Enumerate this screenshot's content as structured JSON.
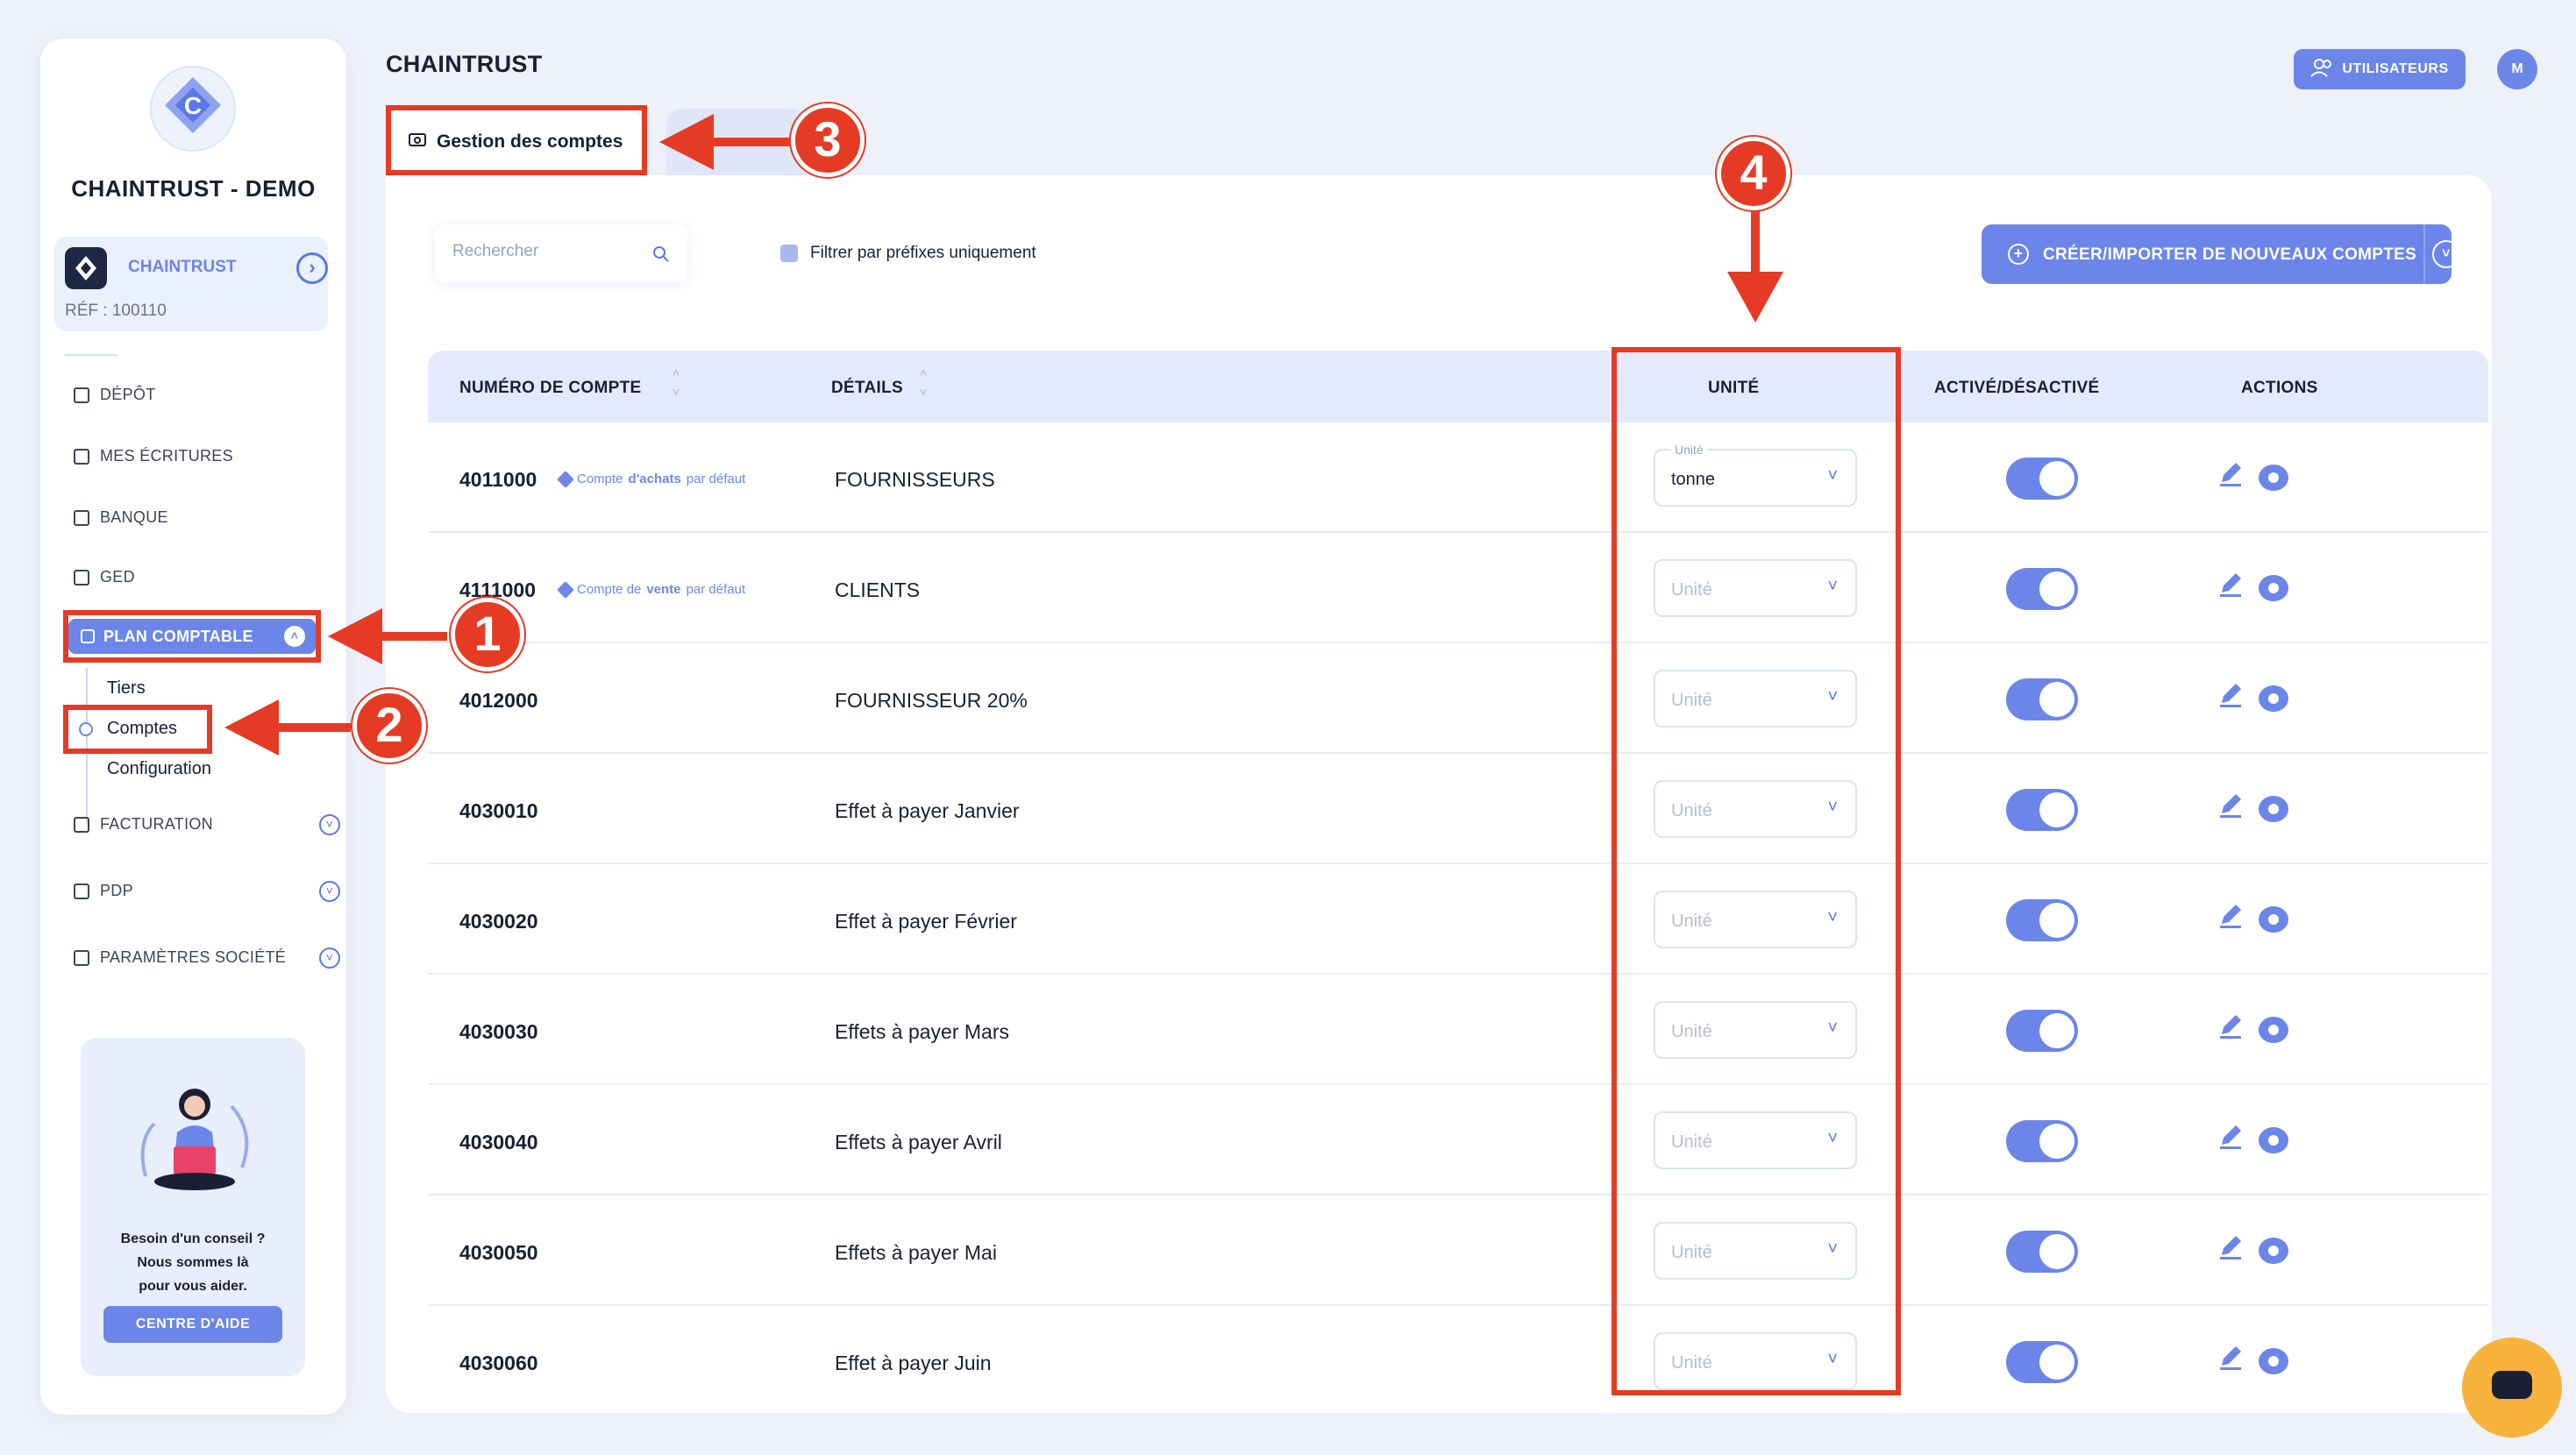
{
  "sidebar": {
    "brand": "CHAINTRUST - DEMO",
    "company": {
      "name": "CHAINTRUST",
      "ref": "RÉF : 100110"
    },
    "nav": [
      {
        "label": "DÉPÔT"
      },
      {
        "label": "MES ÉCRITURES"
      },
      {
        "label": "BANQUE"
      },
      {
        "label": "GED"
      }
    ],
    "active": {
      "label": "PLAN COMPTABLE"
    },
    "subitems": [
      {
        "label": "Tiers"
      },
      {
        "label": "Comptes"
      },
      {
        "label": "Configuration"
      }
    ],
    "nav_bottom": [
      {
        "label": "FACTURATION"
      },
      {
        "label": "PDP"
      },
      {
        "label": "PARAMÈTRES SOCIÉTÉ"
      }
    ],
    "help": {
      "line1": "Besoin d'un conseil ?",
      "line2": "Nous sommes là",
      "line3": "pour vous aider.",
      "button": "CENTRE D'AIDE"
    }
  },
  "header": {
    "title": "CHAINTRUST",
    "users_button": "UTILISATEURS",
    "avatar": "M"
  },
  "tabs": {
    "active": "Gestion des comptes"
  },
  "toolbar": {
    "search_placeholder": "Rechercher",
    "filter_label": "Filtrer par préfixes uniquement",
    "create_button": "CRÉER/IMPORTER DE NOUVEAUX COMPTES"
  },
  "table": {
    "headers": {
      "account": "NUMÉRO DE COMPTE",
      "details": "DÉTAILS",
      "unit": "UNITÉ",
      "active": "ACTIVÉ/DÉSACTIVÉ",
      "actions": "ACTIONS"
    },
    "unit_label": "Unité",
    "rows": [
      {
        "account": "4011000",
        "tag_pre": "Compte",
        "tag_bold": "d'achats",
        "tag_post": "par défaut",
        "details": "FOURNISSEURS",
        "unit": "tonne",
        "active": true
      },
      {
        "account": "4111000",
        "tag_pre": "Compte de",
        "tag_bold": "vente",
        "tag_post": "par défaut",
        "details": "CLIENTS",
        "unit": "",
        "active": true
      },
      {
        "account": "4012000",
        "details": "FOURNISSEUR 20%",
        "unit": "",
        "active": true
      },
      {
        "account": "4030010",
        "details": "Effet à payer Janvier",
        "unit": "",
        "active": true
      },
      {
        "account": "4030020",
        "details": "Effet à payer Février",
        "unit": "",
        "active": true
      },
      {
        "account": "4030030",
        "details": "Effets à payer Mars",
        "unit": "",
        "active": true
      },
      {
        "account": "4030040",
        "details": "Effets à payer Avril",
        "unit": "",
        "active": true
      },
      {
        "account": "4030050",
        "details": "Effets à payer Mai",
        "unit": "",
        "active": true
      },
      {
        "account": "4030060",
        "details": "Effet à payer Juin",
        "unit": "",
        "active": true
      }
    ]
  },
  "annotations": [
    "1",
    "2",
    "3",
    "4"
  ],
  "colors": {
    "accent": "#6b86e8",
    "annotation": "#e53b25",
    "chat": "#f7b33b"
  }
}
